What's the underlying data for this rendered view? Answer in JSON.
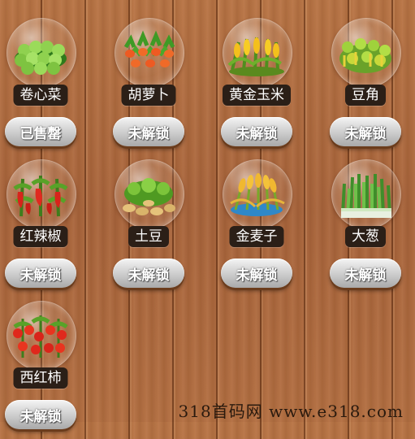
{
  "crops": [
    {
      "name": "卷心菜",
      "action": "已售罄",
      "icon": "cabbage-icon"
    },
    {
      "name": "胡萝卜",
      "action": "未解锁",
      "icon": "carrot-icon"
    },
    {
      "name": "黄金玉米",
      "action": "未解锁",
      "icon": "corn-icon"
    },
    {
      "name": "豆角",
      "action": "未解锁",
      "icon": "green-bean-icon"
    },
    {
      "name": "红辣椒",
      "action": "未解锁",
      "icon": "red-pepper-icon"
    },
    {
      "name": "土豆",
      "action": "未解锁",
      "icon": "potato-icon"
    },
    {
      "name": "金麦子",
      "action": "未解锁",
      "icon": "wheat-icon"
    },
    {
      "name": "大葱",
      "action": "未解锁",
      "icon": "scallion-icon"
    },
    {
      "name": "西红柿",
      "action": "未解锁",
      "icon": "tomato-icon"
    }
  ],
  "watermark": "318首码网  www.e318.com"
}
